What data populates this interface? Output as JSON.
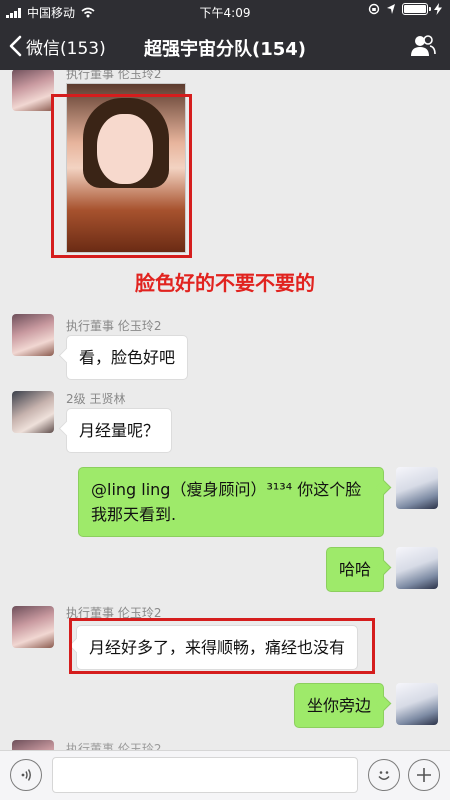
{
  "status_bar": {
    "carrier": "中国移动",
    "time": "下午4:09"
  },
  "nav": {
    "back_label": "微信(153)",
    "title": "超强宇宙分队(154)"
  },
  "messages": [
    {
      "sender": "执行董事 伦玉玲2",
      "type": "image"
    },
    {
      "sender": "执行董事 伦玉玲2",
      "text": "看，脸色好吧"
    },
    {
      "sender": "2级 王贤林",
      "text": "月经量呢？"
    },
    {
      "mine": true,
      "text": "@ling ling（瘦身顾问）³¹³⁴ 你这个脸我那天看到."
    },
    {
      "mine": true,
      "text": "哈哈"
    },
    {
      "sender": "执行董事 伦玉玲2",
      "text": "月经好多了，来得顺畅，痛经也没有"
    },
    {
      "mine": true,
      "text": "坐你旁边"
    },
    {
      "sender": "执行董事 伦玉玲2",
      "text": ""
    }
  ],
  "annotation": {
    "caption": "脸色好的不要不要的"
  },
  "input": {
    "value": ""
  }
}
